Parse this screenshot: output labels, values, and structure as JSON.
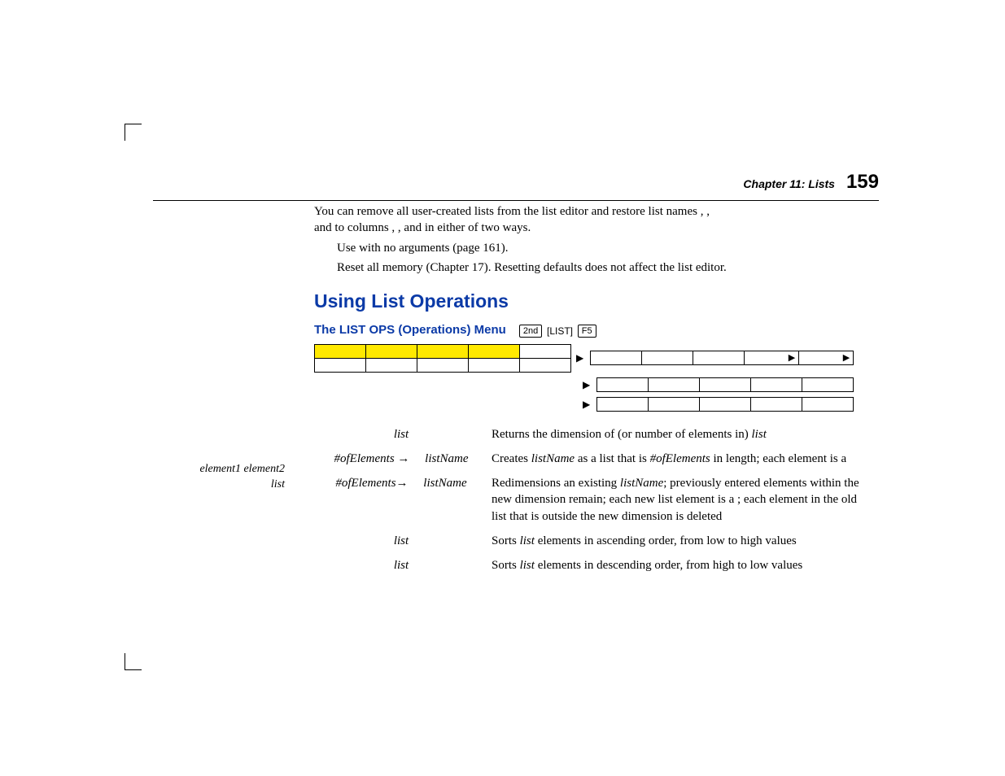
{
  "header": {
    "chapter_label": "Chapter 11: Lists",
    "page_number": "159"
  },
  "intro": {
    "line1a": "You can remove all user-created lists from the list editor and restore list names ",
    "line1b": ", ",
    "line1c": ",",
    "line2a": "and ",
    "line2b": " to columns ",
    "line2c": ", ",
    "line2d": ", and ",
    "line2e": " in either of two ways.",
    "bullet1a": "Use ",
    "bullet1b": " with no arguments (page 161).",
    "bullet2": "Reset all memory (Chapter 17). Resetting defaults does not affect the list editor."
  },
  "section_heading": "Using List Operations",
  "subheading": "The LIST OPS (Operations) Menu",
  "keys": {
    "second": "2nd",
    "list": "LIST",
    "f5": "F5"
  },
  "marginnote_line1": "element1 element2",
  "marginnote_line2": "list",
  "menu": {
    "arrow": "▶"
  },
  "ops": [
    {
      "syntax_a": "list",
      "desc_a": "Returns the dimension of (or number of elements in) ",
      "desc_b": "list"
    },
    {
      "syntax_a": "#ofElements",
      "syntax_arrow": " → ",
      "syntax_b": "listName",
      "desc_a": "Creates ",
      "desc_b": "listName",
      "desc_c": " as a list that is ",
      "desc_d": "#ofElements",
      "desc_e": " in length; each element is a "
    },
    {
      "syntax_a": "#ofElements",
      "syntax_arrow": "→ ",
      "syntax_b": "listName",
      "desc_a": "Redimensions an existing ",
      "desc_b": "listName",
      "desc_c": "; previously entered elements within the new dimension remain; each new list element is a ",
      "desc_d": "; each element in the old list that is outside the new dimension is deleted"
    },
    {
      "syntax_a": "list",
      "desc_a": "Sorts ",
      "desc_b": "list",
      "desc_c": " elements in ascending order, from low to high values"
    },
    {
      "syntax_a": "list",
      "desc_a": "Sorts ",
      "desc_b": "list",
      "desc_c": " elements in descending order, from high to low values"
    }
  ]
}
